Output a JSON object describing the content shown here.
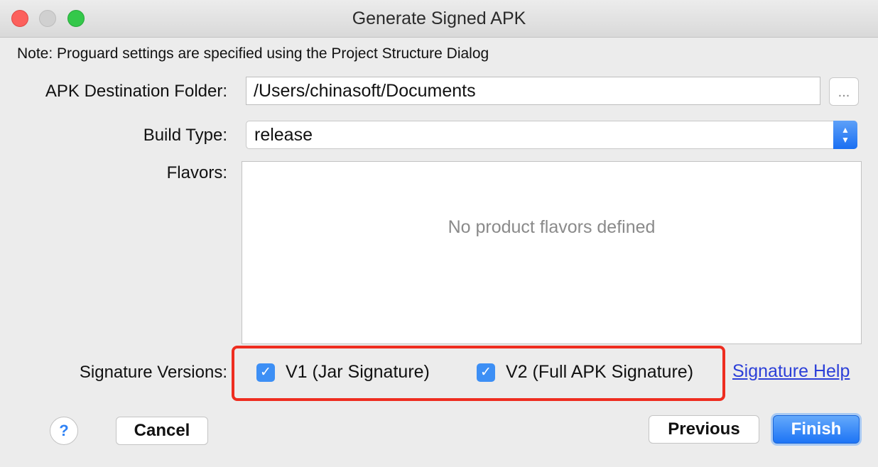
{
  "window": {
    "title": "Generate Signed APK"
  },
  "note": "Note: Proguard settings are specified using the Project Structure Dialog",
  "destination": {
    "label": "APK Destination Folder:",
    "value": "/Users/chinasoft/Documents",
    "browse_label": "..."
  },
  "build_type": {
    "label": "Build Type:",
    "value": "release"
  },
  "flavors": {
    "label": "Flavors:",
    "empty_text": "No product flavors defined"
  },
  "signature": {
    "label": "Signature Versions:",
    "v1": {
      "label": "V1 (Jar Signature)",
      "checked": true
    },
    "v2": {
      "label": "V2 (Full APK Signature)",
      "checked": true
    },
    "help_link": "Signature Help"
  },
  "buttons": {
    "help": "?",
    "cancel": "Cancel",
    "previous": "Previous",
    "finish": "Finish"
  },
  "colors": {
    "accent": "#3d8ff5",
    "highlight_box": "#ee2d20",
    "link": "#2b3fd8"
  }
}
